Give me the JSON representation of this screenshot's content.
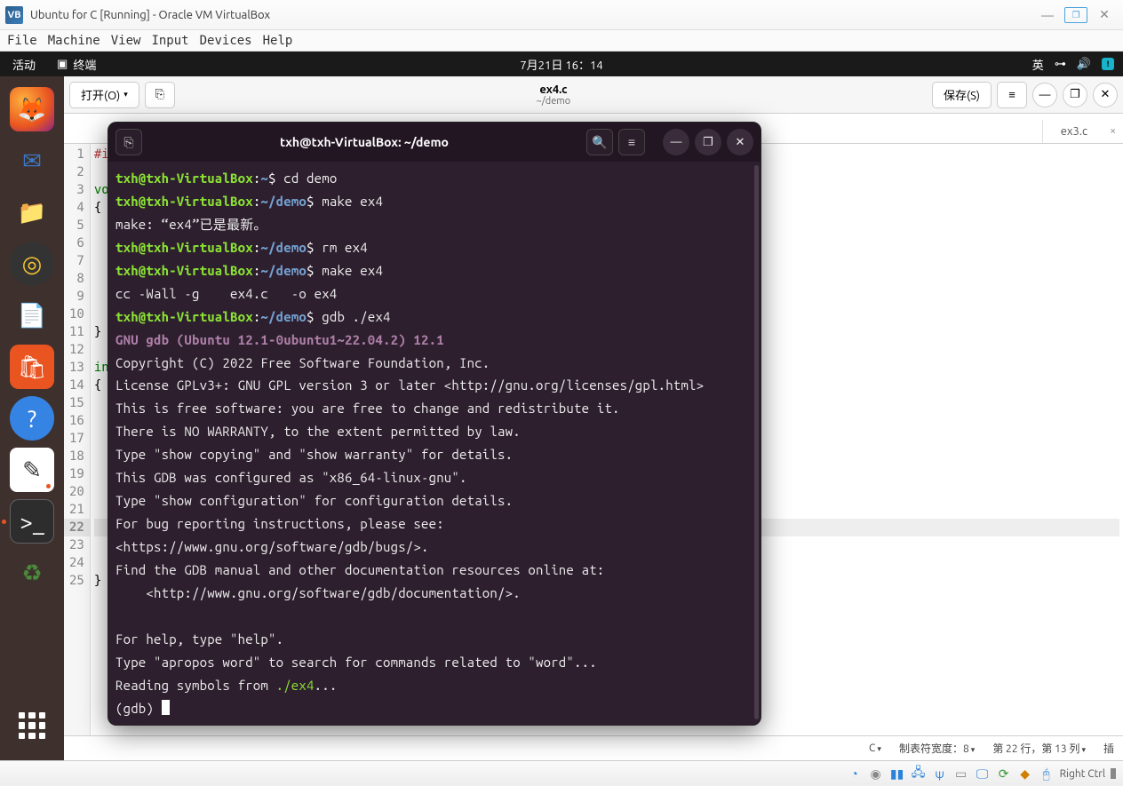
{
  "vbox": {
    "title": "Ubuntu for C [Running] - Oracle VM VirtualBox",
    "menu": [
      "File",
      "Machine",
      "View",
      "Input",
      "Devices",
      "Help"
    ],
    "host_key": "Right Ctrl"
  },
  "ubuntu": {
    "activities": "活动",
    "app_label": "终端",
    "datetime": "7月21日  16：14",
    "lang": "英"
  },
  "gedit": {
    "open": "打开(O)",
    "save": "保存(S)",
    "title_file": "ex4.c",
    "title_path": "~/demo",
    "tab2": "ex3.c",
    "gutter": [
      "1",
      "2",
      "3",
      "4",
      "5",
      "6",
      "7",
      "8",
      "9",
      "10",
      "11",
      "12",
      "13",
      "14",
      "15",
      "16",
      "17",
      "18",
      "19",
      "20",
      "21",
      "22",
      "23",
      "24",
      "25"
    ],
    "code_visible": [
      "#i",
      "",
      "voi",
      "{",
      "",
      "",
      "",
      "",
      "",
      "",
      "}",
      "",
      "int",
      "{",
      "",
      "",
      "",
      "",
      "",
      "",
      "",
      "",
      "",
      "",
      "}"
    ],
    "status_lang": "C",
    "status_tab": "制表符宽度：8",
    "status_pos": "第 22 行，第 13 列",
    "status_ins": "插"
  },
  "terminal": {
    "title": "txh@txh-VirtualBox: ~/demo",
    "prompt_user": "txh@txh-VirtualBox",
    "home_path": "~",
    "demo_path": "~/demo",
    "cmd1": "cd demo",
    "cmd2": "make ex4",
    "msg_uptodate": "make: “ex4”已是最新。",
    "cmd3": "rm ex4",
    "cmd4": "make ex4",
    "cc_line": "cc -Wall -g    ex4.c   -o ex4",
    "cmd5": "gdb ./ex4",
    "gdb_version": "GNU gdb (Ubuntu 12.1-0ubuntu1~22.04.2) 12.1",
    "gdb_lines": [
      "Copyright (C) 2022 Free Software Foundation, Inc.",
      "License GPLv3+: GNU GPL version 3 or later <http://gnu.org/licenses/gpl.html>",
      "This is free software: you are free to change and redistribute it.",
      "There is NO WARRANTY, to the extent permitted by law.",
      "Type \"show copying\" and \"show warranty\" for details.",
      "This GDB was configured as \"x86_64-linux-gnu\".",
      "Type \"show configuration\" for configuration details.",
      "For bug reporting instructions, please see:",
      "<https://www.gnu.org/software/gdb/bugs/>.",
      "Find the GDB manual and other documentation resources online at:",
      "    <http://www.gnu.org/software/gdb/documentation/>.",
      "",
      "For help, type \"help\".",
      "Type \"apropos word\" to search for commands related to \"word\"..."
    ],
    "reading_prefix": "Reading symbols from ",
    "reading_path": "./ex4",
    "reading_suffix": "...",
    "gdb_prompt": "(gdb) "
  }
}
